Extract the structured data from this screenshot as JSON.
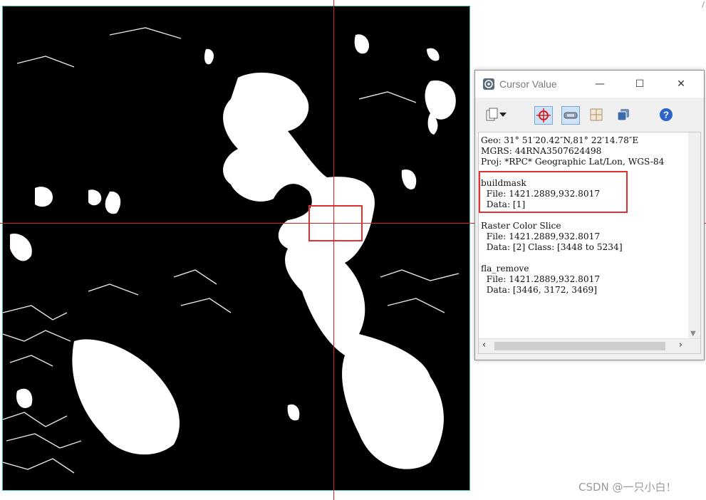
{
  "window": {
    "title": "Cursor Value",
    "minimize_glyph": "—",
    "maximize_glyph": "☐",
    "close_glyph": "✕"
  },
  "toolbar": {
    "icons": [
      "copy-icon",
      "dropdown-arrow-icon",
      "crosshair-icon",
      "link-icon",
      "grid-icon",
      "layers-icon",
      "help-icon"
    ]
  },
  "cursor_info": {
    "geo": "Geo: 31° 51′20.42″N,81° 22′14.78″E",
    "mgrs": "MGRS: 44RNA3507624498",
    "proj": "Proj: *RPC* Geographic Lat/Lon, WGS-84",
    "layers": [
      {
        "name": "buildmask",
        "file": "  File: 1421.2889,932.8017",
        "data": "  Data: [1]"
      },
      {
        "name": "Raster Color Slice",
        "file": "  File: 1421.2889,932.8017",
        "data": "  Data: [2] Class: [3448 to 5234]"
      },
      {
        "name": "fla_remove",
        "file": "  File: 1421.2889,932.8017",
        "data": "  Data: [3446, 3172, 3469]"
      }
    ]
  },
  "colors": {
    "crosshair": "#e02020",
    "highlight": "#e03030",
    "raster_border": "#3fb6b6"
  },
  "watermark": "CSDN @一只小白！",
  "corner_mark": "/"
}
